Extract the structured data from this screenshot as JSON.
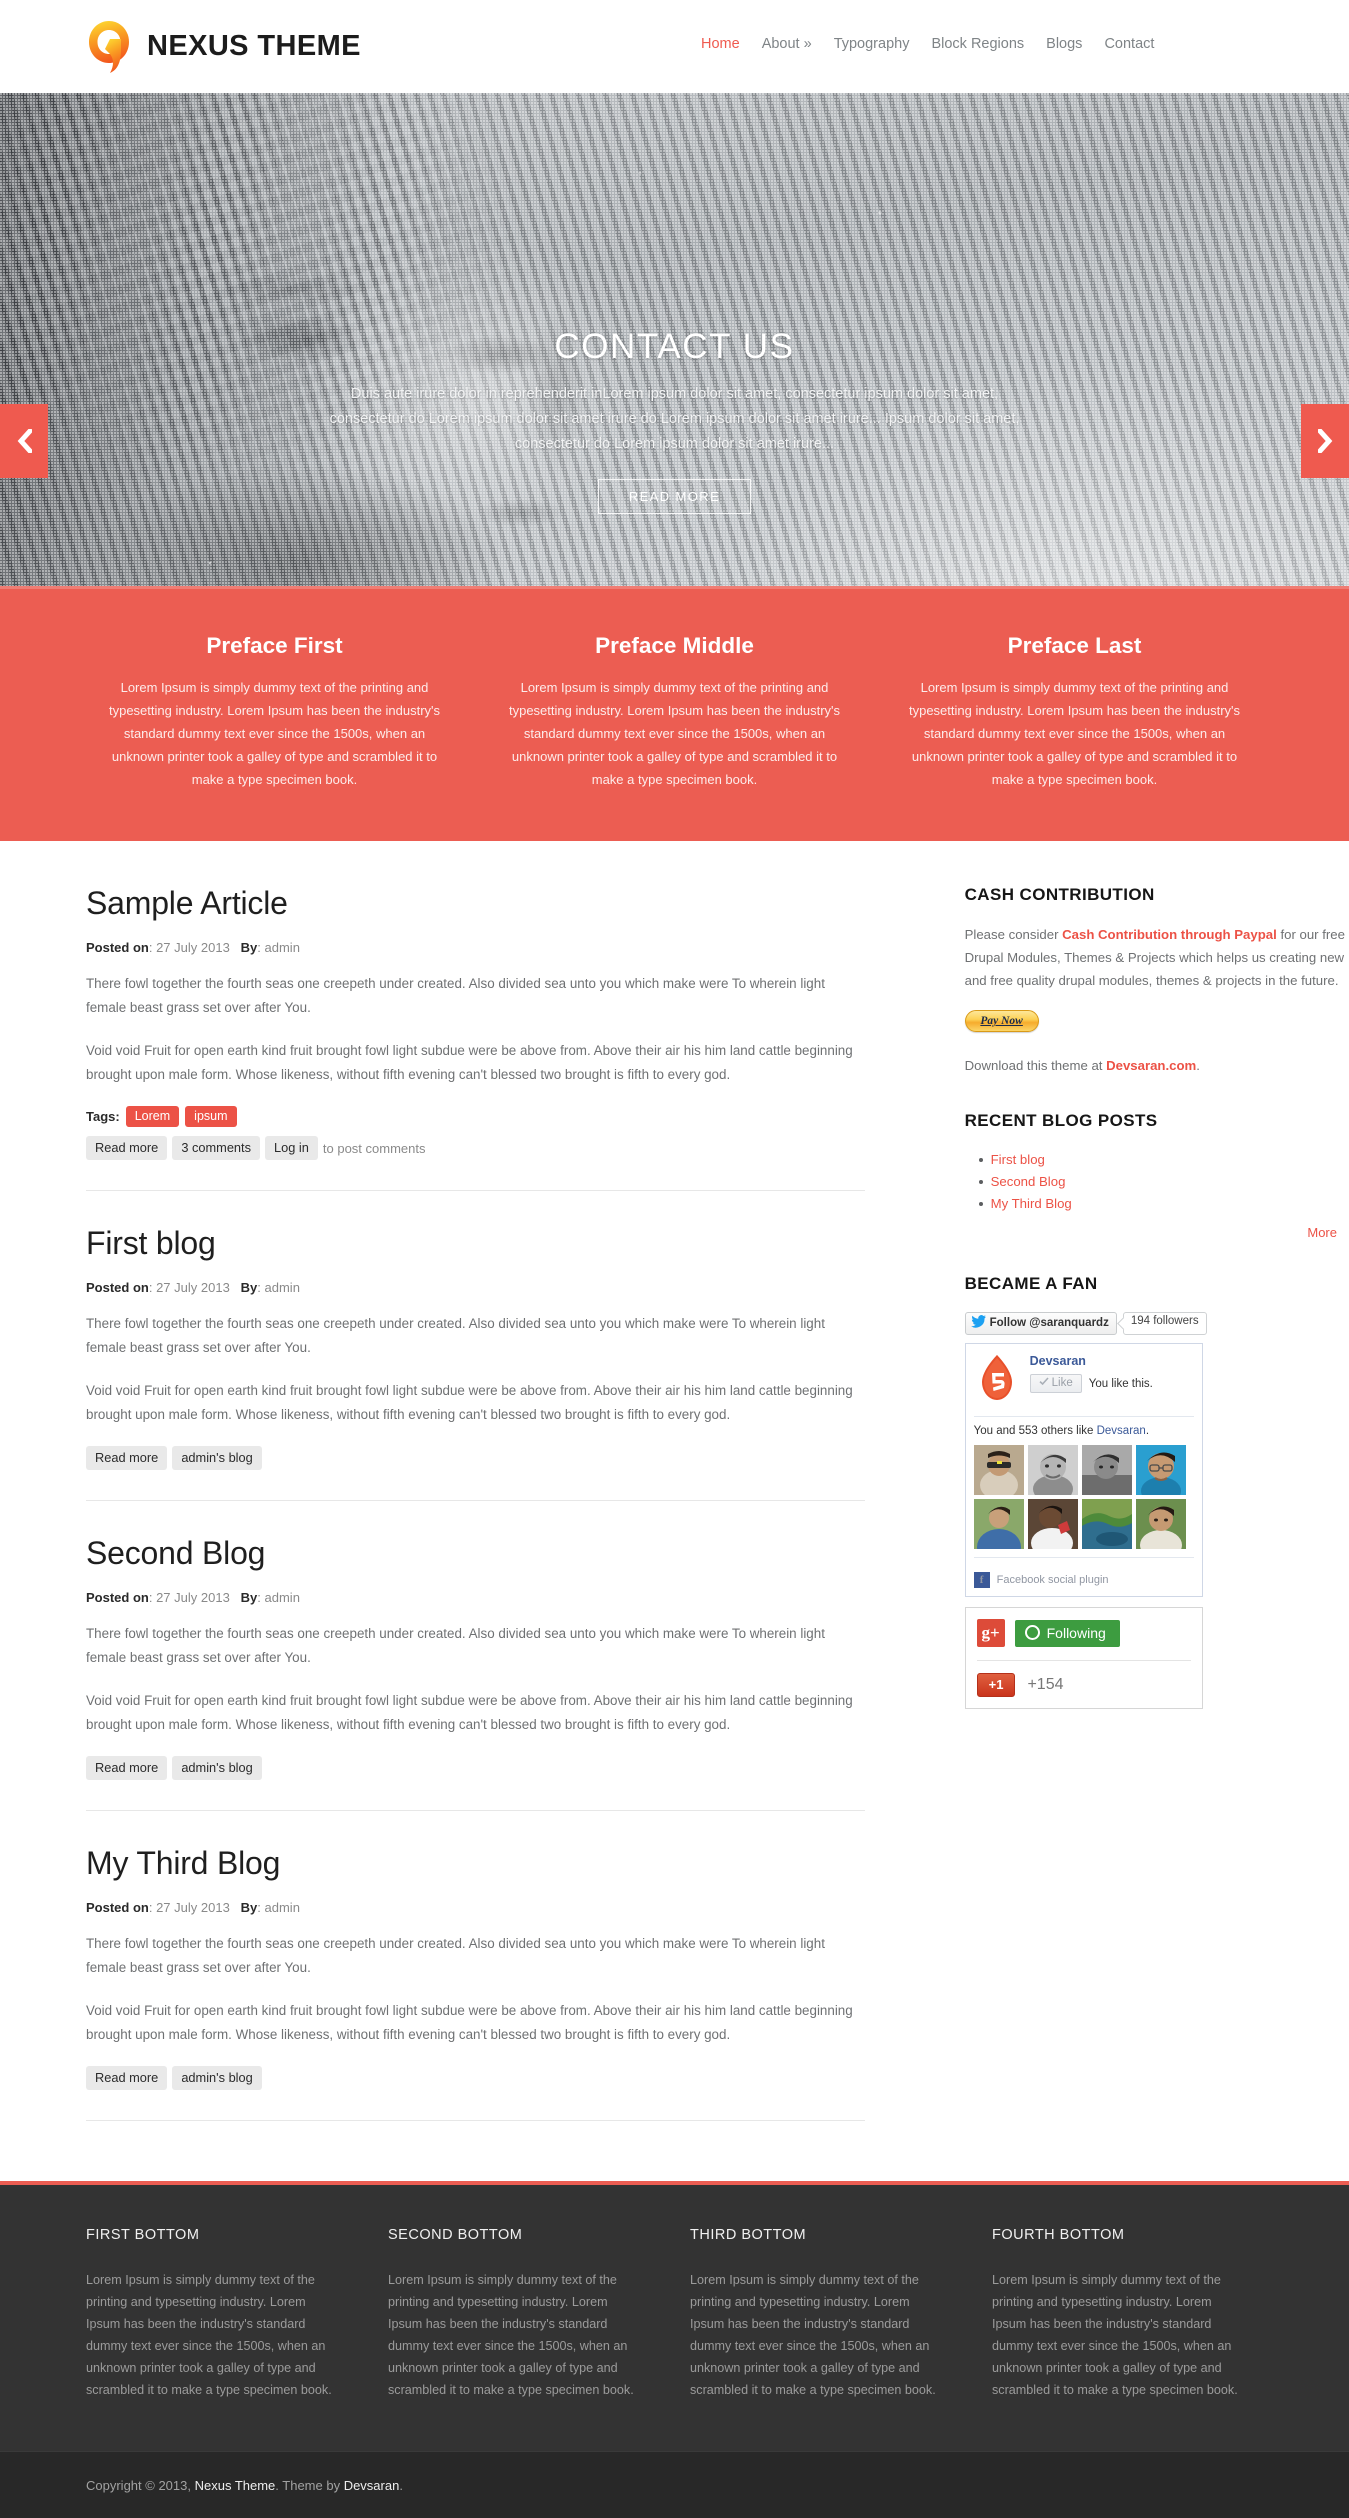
{
  "header": {
    "brand": "NEXUS THEME",
    "logo_icon": "nexus-q-logo",
    "nav": [
      {
        "label": "Home",
        "active": true
      },
      {
        "label": "About »",
        "active": false
      },
      {
        "label": "Typography",
        "active": false
      },
      {
        "label": "Block Regions",
        "active": false
      },
      {
        "label": "Blogs",
        "active": false
      },
      {
        "label": "Contact",
        "active": false
      }
    ]
  },
  "hero": {
    "title": "CONTACT US",
    "description": "Duis aute irure dolor in reprehenderit inLorem ipsum dolor sit amet, consectetur ipsum dolor sit amet, consectetur do Lorem ipsum dolor sit amet irure do Lorem ipsum dolor sit amet irure... Ipsum dolor sit amet, consectetur do Lorem ipsum dolor sit amet irure...",
    "button_label": "READ MORE",
    "prev_icon": "chevron-left-icon",
    "next_icon": "chevron-right-icon",
    "accent": "#ef5a4f"
  },
  "preface": {
    "background": "#ec5d52",
    "columns": [
      {
        "title": "Preface First",
        "body": "Lorem Ipsum is simply dummy text of the printing and typesetting industry. Lorem Ipsum has been the industry's standard dummy text ever since the 1500s, when an unknown printer took a galley of type and scrambled it to make a type specimen book."
      },
      {
        "title": "Preface Middle",
        "body": "Lorem Ipsum is simply dummy text of the printing and typesetting industry. Lorem Ipsum has been the industry's standard dummy text ever since the 1500s, when an unknown printer took a galley of type and scrambled it to make a type specimen book."
      },
      {
        "title": "Preface Last",
        "body": "Lorem Ipsum is simply dummy text of the printing and typesetting industry. Lorem Ipsum has been the industry's standard dummy text ever since the 1500s, when an unknown printer took a galley of type and scrambled it to make a type specimen book."
      }
    ]
  },
  "articles": [
    {
      "title": "Sample Article",
      "posted_label": "Posted on",
      "date": "27 July 2013",
      "by_label": "By",
      "author": "admin",
      "para1": "There fowl together the fourth seas one creepeth under created. Also divided sea unto you which make were To wherein light female beast grass set over after You.",
      "para2": "Void void Fruit for open earth kind fruit brought fowl light subdue were be above from. Above their air his him land cattle beginning brought upon male form. Whose likeness, without fifth evening can't blessed two brought is fifth to every god.",
      "tags_label": "Tags",
      "tags": [
        "Lorem",
        "ipsum"
      ],
      "links": [
        "Read more",
        "3 comments",
        "Log in"
      ],
      "links_suffix": "to post comments"
    },
    {
      "title": "First blog",
      "posted_label": "Posted on",
      "date": "27 July 2013",
      "by_label": "By",
      "author": "admin",
      "para1": "There fowl together the fourth seas one creepeth under created. Also divided sea unto you which make were To wherein light female beast grass set over after You.",
      "para2": "Void void Fruit for open earth kind fruit brought fowl light subdue were be above from. Above their air his him land cattle beginning brought upon male form. Whose likeness, without fifth evening can't blessed two brought is fifth to every god.",
      "links": [
        "Read more",
        "admin's blog"
      ]
    },
    {
      "title": "Second Blog",
      "posted_label": "Posted on",
      "date": "27 July 2013",
      "by_label": "By",
      "author": "admin",
      "para1": "There fowl together the fourth seas one creepeth under created. Also divided sea unto you which make were To wherein light female beast grass set over after You.",
      "para2": "Void void Fruit for open earth kind fruit brought fowl light subdue were be above from. Above their air his him land cattle beginning brought upon male form. Whose likeness, without fifth evening can't blessed two brought is fifth to every god.",
      "links": [
        "Read more",
        "admin's blog"
      ]
    },
    {
      "title": "My Third Blog",
      "posted_label": "Posted on",
      "date": "27 July 2013",
      "by_label": "By",
      "author": "admin",
      "para1": "There fowl together the fourth seas one creepeth under created. Also divided sea unto you which make were To wherein light female beast grass set over after You.",
      "para2": "Void void Fruit for open earth kind fruit brought fowl light subdue were be above from. Above their air his him land cattle beginning brought upon male form. Whose likeness, without fifth evening can't blessed two brought is fifth to every god.",
      "links": [
        "Read more",
        "admin's blog"
      ]
    }
  ],
  "sidebar": {
    "cash": {
      "title": "CASH CONTRIBUTION",
      "text_before": "Please consider ",
      "link": "Cash Contribution through Paypal",
      "text_after": " for our free Drupal Modules, Themes & Projects which helps us creating new and free quality drupal modules, themes & projects in the future.",
      "paypal_label": "Pay Now",
      "download_before": "Download this theme at ",
      "download_link": "Devsaran.com",
      "download_after": "."
    },
    "recent": {
      "title": "RECENT BLOG POSTS",
      "items": [
        "First blog",
        "Second Blog",
        "My Third Blog"
      ],
      "more_label": "More"
    },
    "fan": {
      "title": "BECAME A FAN",
      "twitter_icon": "twitter-bird-icon",
      "twitter_follow": "Follow @saranquardz",
      "twitter_followers": "194 followers",
      "fb_page_name": "Devsaran",
      "fb_logo_icon": "drupal-html5-drop-icon",
      "fb_like_label": "Like",
      "fb_like_check_icon": "check-icon",
      "fb_like_state": "You like this.",
      "fb_others_before": "You and 553 others like ",
      "fb_others_link": "Devsaran",
      "fb_others_after": ".",
      "fb_plugin_label": "Facebook social plugin",
      "fb_plugin_icon": "facebook-f-icon",
      "gp_icon": "google-plus-icon",
      "gp_following": "Following",
      "gp_following_icon": "circle-outline-icon",
      "gp_plusone": "+1",
      "gp_count": "+154"
    }
  },
  "footer": {
    "accent": "#ec5d52",
    "columns": [
      {
        "title": "FIRST BOTTOM",
        "body": "Lorem Ipsum is simply dummy text of the printing and typesetting industry. Lorem Ipsum has been the industry's standard dummy text ever since the 1500s, when an unknown printer took a galley of type and scrambled it to make a type specimen book."
      },
      {
        "title": "SECOND BOTTOM",
        "body": "Lorem Ipsum is simply dummy text of the printing and typesetting industry. Lorem Ipsum has been the industry's standard dummy text ever since the 1500s, when an unknown printer took a galley of type and scrambled it to make a type specimen book."
      },
      {
        "title": "THIRD BOTTOM",
        "body": "Lorem Ipsum is simply dummy text of the printing and typesetting industry. Lorem Ipsum has been the industry's standard dummy text ever since the 1500s, when an unknown printer took a galley of type and scrambled it to make a type specimen book."
      },
      {
        "title": "FOURTH BOTTOM",
        "body": "Lorem Ipsum is simply dummy text of the printing and typesetting industry. Lorem Ipsum has been the industry's standard dummy text ever since the 1500s, when an unknown printer took a galley of type and scrambled it to make a type specimen book."
      }
    ],
    "copyright_before": "Copyright © 2013, ",
    "copyright_link1": "Nexus Theme",
    "copyright_mid": ". Theme by ",
    "copyright_link2": "Devsaran",
    "copyright_after": "."
  }
}
